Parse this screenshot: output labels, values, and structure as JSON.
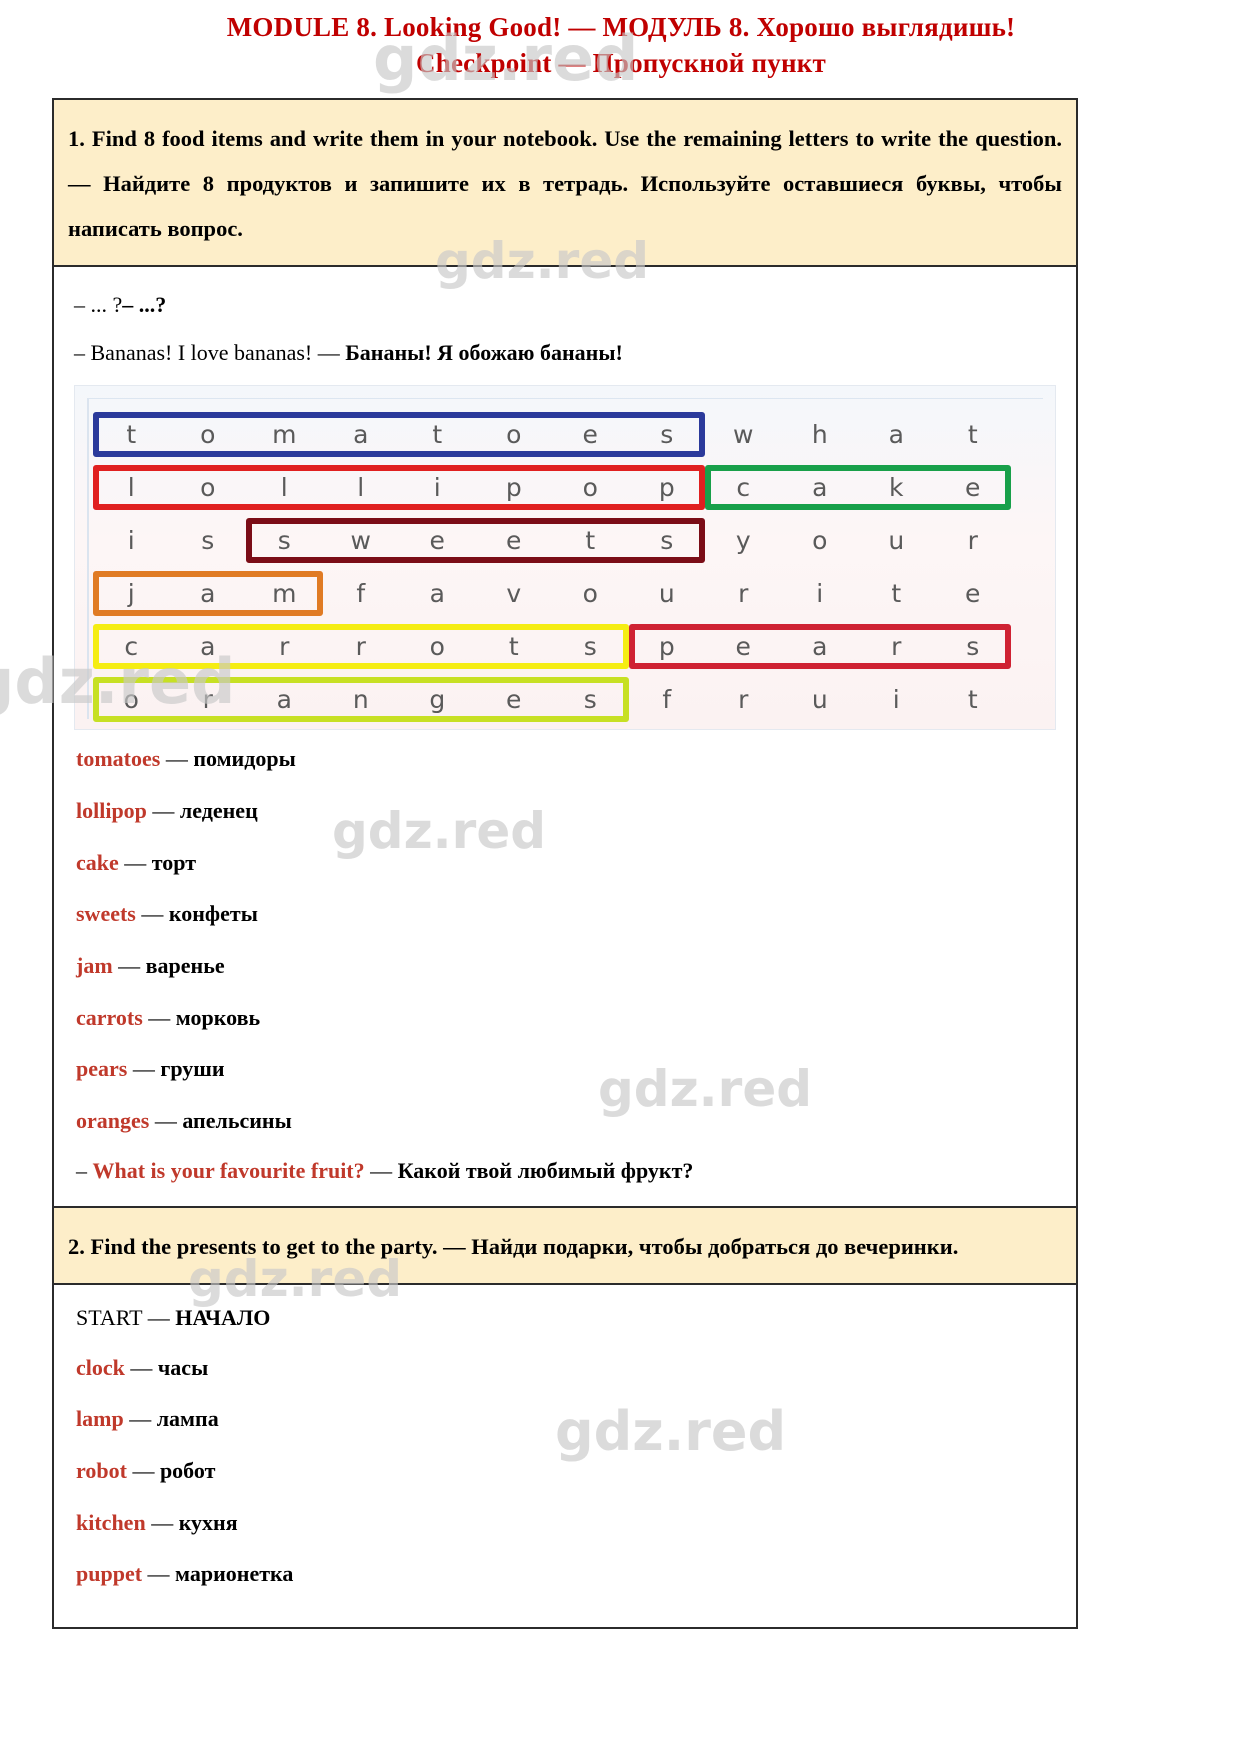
{
  "title": {
    "line1": "MODULE 8. Looking Good! — МОДУЛЬ 8. Хорошо выглядишь!",
    "line2": "Checkpoint — Пропускной пункт",
    "color": "#c00000"
  },
  "watermark": {
    "text": "gdz.red"
  },
  "task1": {
    "prompt": "1. Find 8 food items and write them in your notebook. Use the remaining letters to write the question. — Найдите 8 продуктов и запишите их в тетрадь. Используйте оставшиеся буквы, чтобы написать вопрос.",
    "dialog_prompt_plain": "– ... ?",
    "dialog_prompt_bold": "– ...?",
    "dialog_answer_en": "– Bananas! I love bananas! — ",
    "dialog_answer_ru": "Бананы! Я обожаю бананы!",
    "puzzle": {
      "rows": 6,
      "cols": 12,
      "grid": [
        [
          "t",
          "o",
          "m",
          "a",
          "t",
          "o",
          "e",
          "s",
          "w",
          "h",
          "a",
          "t"
        ],
        [
          "l",
          "o",
          "l",
          "l",
          "i",
          "p",
          "o",
          "p",
          "c",
          "a",
          "k",
          "e"
        ],
        [
          "i",
          "s",
          "s",
          "w",
          "e",
          "e",
          "t",
          "s",
          "y",
          "o",
          "u",
          "r"
        ],
        [
          "j",
          "a",
          "m",
          "f",
          "a",
          "v",
          "o",
          "u",
          "r",
          "i",
          "t",
          "e"
        ],
        [
          "c",
          "a",
          "r",
          "r",
          "o",
          "t",
          "s",
          "p",
          "e",
          "a",
          "r",
          "s"
        ],
        [
          "o",
          "r",
          "a",
          "n",
          "g",
          "e",
          "s",
          "f",
          "r",
          "u",
          "i",
          "t"
        ]
      ],
      "highlights": [
        {
          "word": "tomatoes",
          "row": 0,
          "col_start": 0,
          "col_end": 7,
          "color": "#2b3a9b"
        },
        {
          "word": "lollipop",
          "row": 1,
          "col_start": 0,
          "col_end": 7,
          "color": "#e02020"
        },
        {
          "word": "cake",
          "row": 1,
          "col_start": 8,
          "col_end": 11,
          "color": "#18a04a"
        },
        {
          "word": "sweets",
          "row": 2,
          "col_start": 2,
          "col_end": 7,
          "color": "#7b0d17"
        },
        {
          "word": "jam",
          "row": 3,
          "col_start": 0,
          "col_end": 2,
          "color": "#e07b24"
        },
        {
          "word": "carrots",
          "row": 4,
          "col_start": 0,
          "col_end": 6,
          "color": "#f5ed13"
        },
        {
          "word": "pears",
          "row": 4,
          "col_start": 7,
          "col_end": 11,
          "color": "#cf2233"
        },
        {
          "word": "oranges",
          "row": 5,
          "col_start": 0,
          "col_end": 6,
          "color": "#c7e024"
        }
      ]
    },
    "vocabulary": [
      {
        "en": "tomatoes",
        "ru": "помидоры"
      },
      {
        "en": "lollipop",
        "ru": "леденец"
      },
      {
        "en": "cake",
        "ru": "торт"
      },
      {
        "en": "sweets",
        "ru": "конфеты"
      },
      {
        "en": "jam",
        "ru": "варенье"
      },
      {
        "en": "carrots",
        "ru": "морковь"
      },
      {
        "en": "pears",
        "ru": "груши"
      },
      {
        "en": "oranges",
        "ru": "апельсины"
      }
    ],
    "question_dash": "–",
    "question_en": "What is your favourite fruit?",
    "question_sep": " — ",
    "question_ru": "Какой твой любимый фрукт?"
  },
  "task2": {
    "prompt": "2. Find the presents to get to the party. —  Найди подарки, чтобы добраться до вечеринки.",
    "start_en": "START",
    "start_sep": " — ",
    "start_ru": "НАЧАЛО",
    "vocabulary": [
      {
        "en": "clock",
        "ru": "часы"
      },
      {
        "en": "lamp",
        "ru": "лампа"
      },
      {
        "en": "robot",
        "ru": "робот"
      },
      {
        "en": "kitchen",
        "ru": "кухня"
      },
      {
        "en": "puppet",
        "ru": "марионетка"
      }
    ]
  },
  "separator": "—"
}
